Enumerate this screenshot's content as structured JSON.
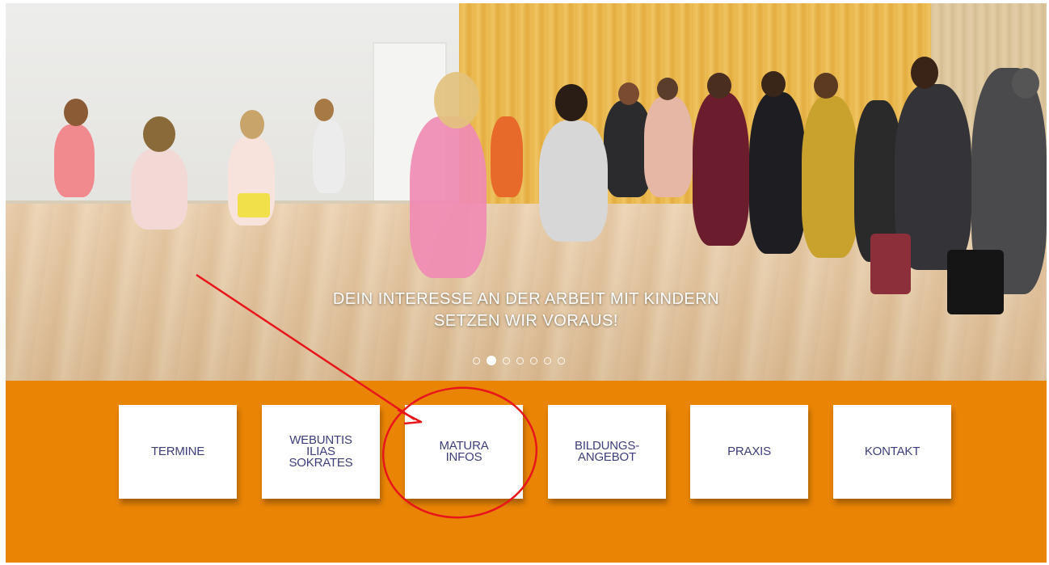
{
  "hero": {
    "caption_line1": "DEIN INTERESSE AN DER ARBEIT MIT KINDERN",
    "caption_line2": "SETZEN WIR VORAUS!",
    "slides_total": 7,
    "active_slide": 2
  },
  "tiles": [
    {
      "label": "TERMINE"
    },
    {
      "label": "WEBUNTIS\nILIAS\nSOKRATES"
    },
    {
      "label": "MATURA\nINFOS"
    },
    {
      "label": "BILDUNGS-\nANGEBOT"
    },
    {
      "label": "PRAXIS"
    },
    {
      "label": "KONTAKT"
    }
  ],
  "colors": {
    "band": "#e98405",
    "tile_text": "#3d3d7a",
    "annotation": "#e8161b"
  },
  "annotation": {
    "type": "arrow-and-circle",
    "highlighted_tile": "MATURA\nINFOS"
  }
}
